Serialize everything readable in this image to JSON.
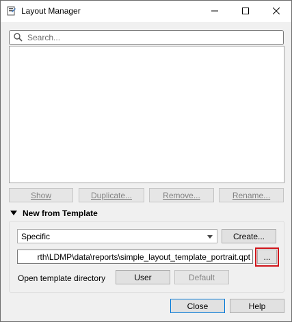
{
  "window": {
    "title": "Layout Manager",
    "controls": {
      "minimize": "minimize-icon",
      "maximize": "maximize-icon",
      "close": "close-icon"
    }
  },
  "search": {
    "placeholder": "Search..."
  },
  "list_buttons": {
    "show": "Show",
    "duplicate": "Duplicate...",
    "remove": "Remove...",
    "rename": "Rename..."
  },
  "template_section": {
    "header": "New from Template",
    "combo_value": "Specific",
    "create_label": "Create...",
    "path_value": "rth\\LDMP\\data\\reports\\simple_layout_template_portrait.qpt",
    "browse_label": "...",
    "open_dir_label": "Open template directory",
    "user_label": "User",
    "default_label": "Default"
  },
  "footer": {
    "close_label": "Close",
    "help_label": "Help"
  },
  "colors": {
    "highlight": "#d0141a",
    "button_bg": "#e1e1e1",
    "window_bg": "#f0f0f0"
  }
}
